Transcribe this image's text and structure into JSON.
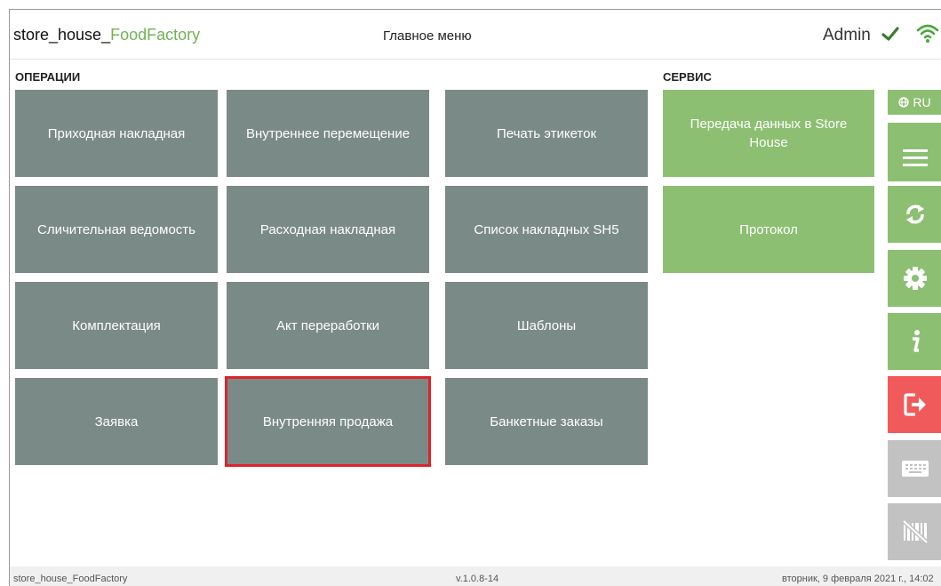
{
  "header": {
    "app_name_part1": "store_house_",
    "app_name_part2": "FoodFactory",
    "title": "Главное меню",
    "user": "Admin",
    "status_icon": "check-icon",
    "network_icon": "wifi-icon"
  },
  "sections": {
    "operations_label": "ОПЕРАЦИИ",
    "service_label": "СЕРВИС"
  },
  "operations": [
    [
      "Приходная накладная",
      "Внутреннее перемещение",
      "Печать этикеток"
    ],
    [
      "Сличительная ведомость",
      "Расходная накладная",
      "Список накладных SH5"
    ],
    [
      "Комплектация",
      "Акт переработки",
      "Шаблоны"
    ],
    [
      "Заявка",
      "Внутренняя продажа",
      "Банкетные заказы"
    ]
  ],
  "service": [
    "Передача данных в Store House",
    "Протокол"
  ],
  "sidebar": {
    "language": "RU",
    "buttons": [
      "globe-icon",
      "menu-icon",
      "sync-icon",
      "settings-icon",
      "info-icon",
      "logout-icon",
      "keyboard-icon",
      "barcode-off-icon"
    ]
  },
  "footer": {
    "app": "store_house_FoodFactory",
    "version": "v.1.0.8-14",
    "datetime": "вторник, 9 февраля 2021 г., 14:02"
  },
  "colors": {
    "tile_gray": "#7a8a87",
    "tile_green": "#8cbf72",
    "danger": "#f05a5a",
    "disabled": "#c2c2c2",
    "highlight": "#e0232b",
    "brand_green": "#6fb353"
  }
}
